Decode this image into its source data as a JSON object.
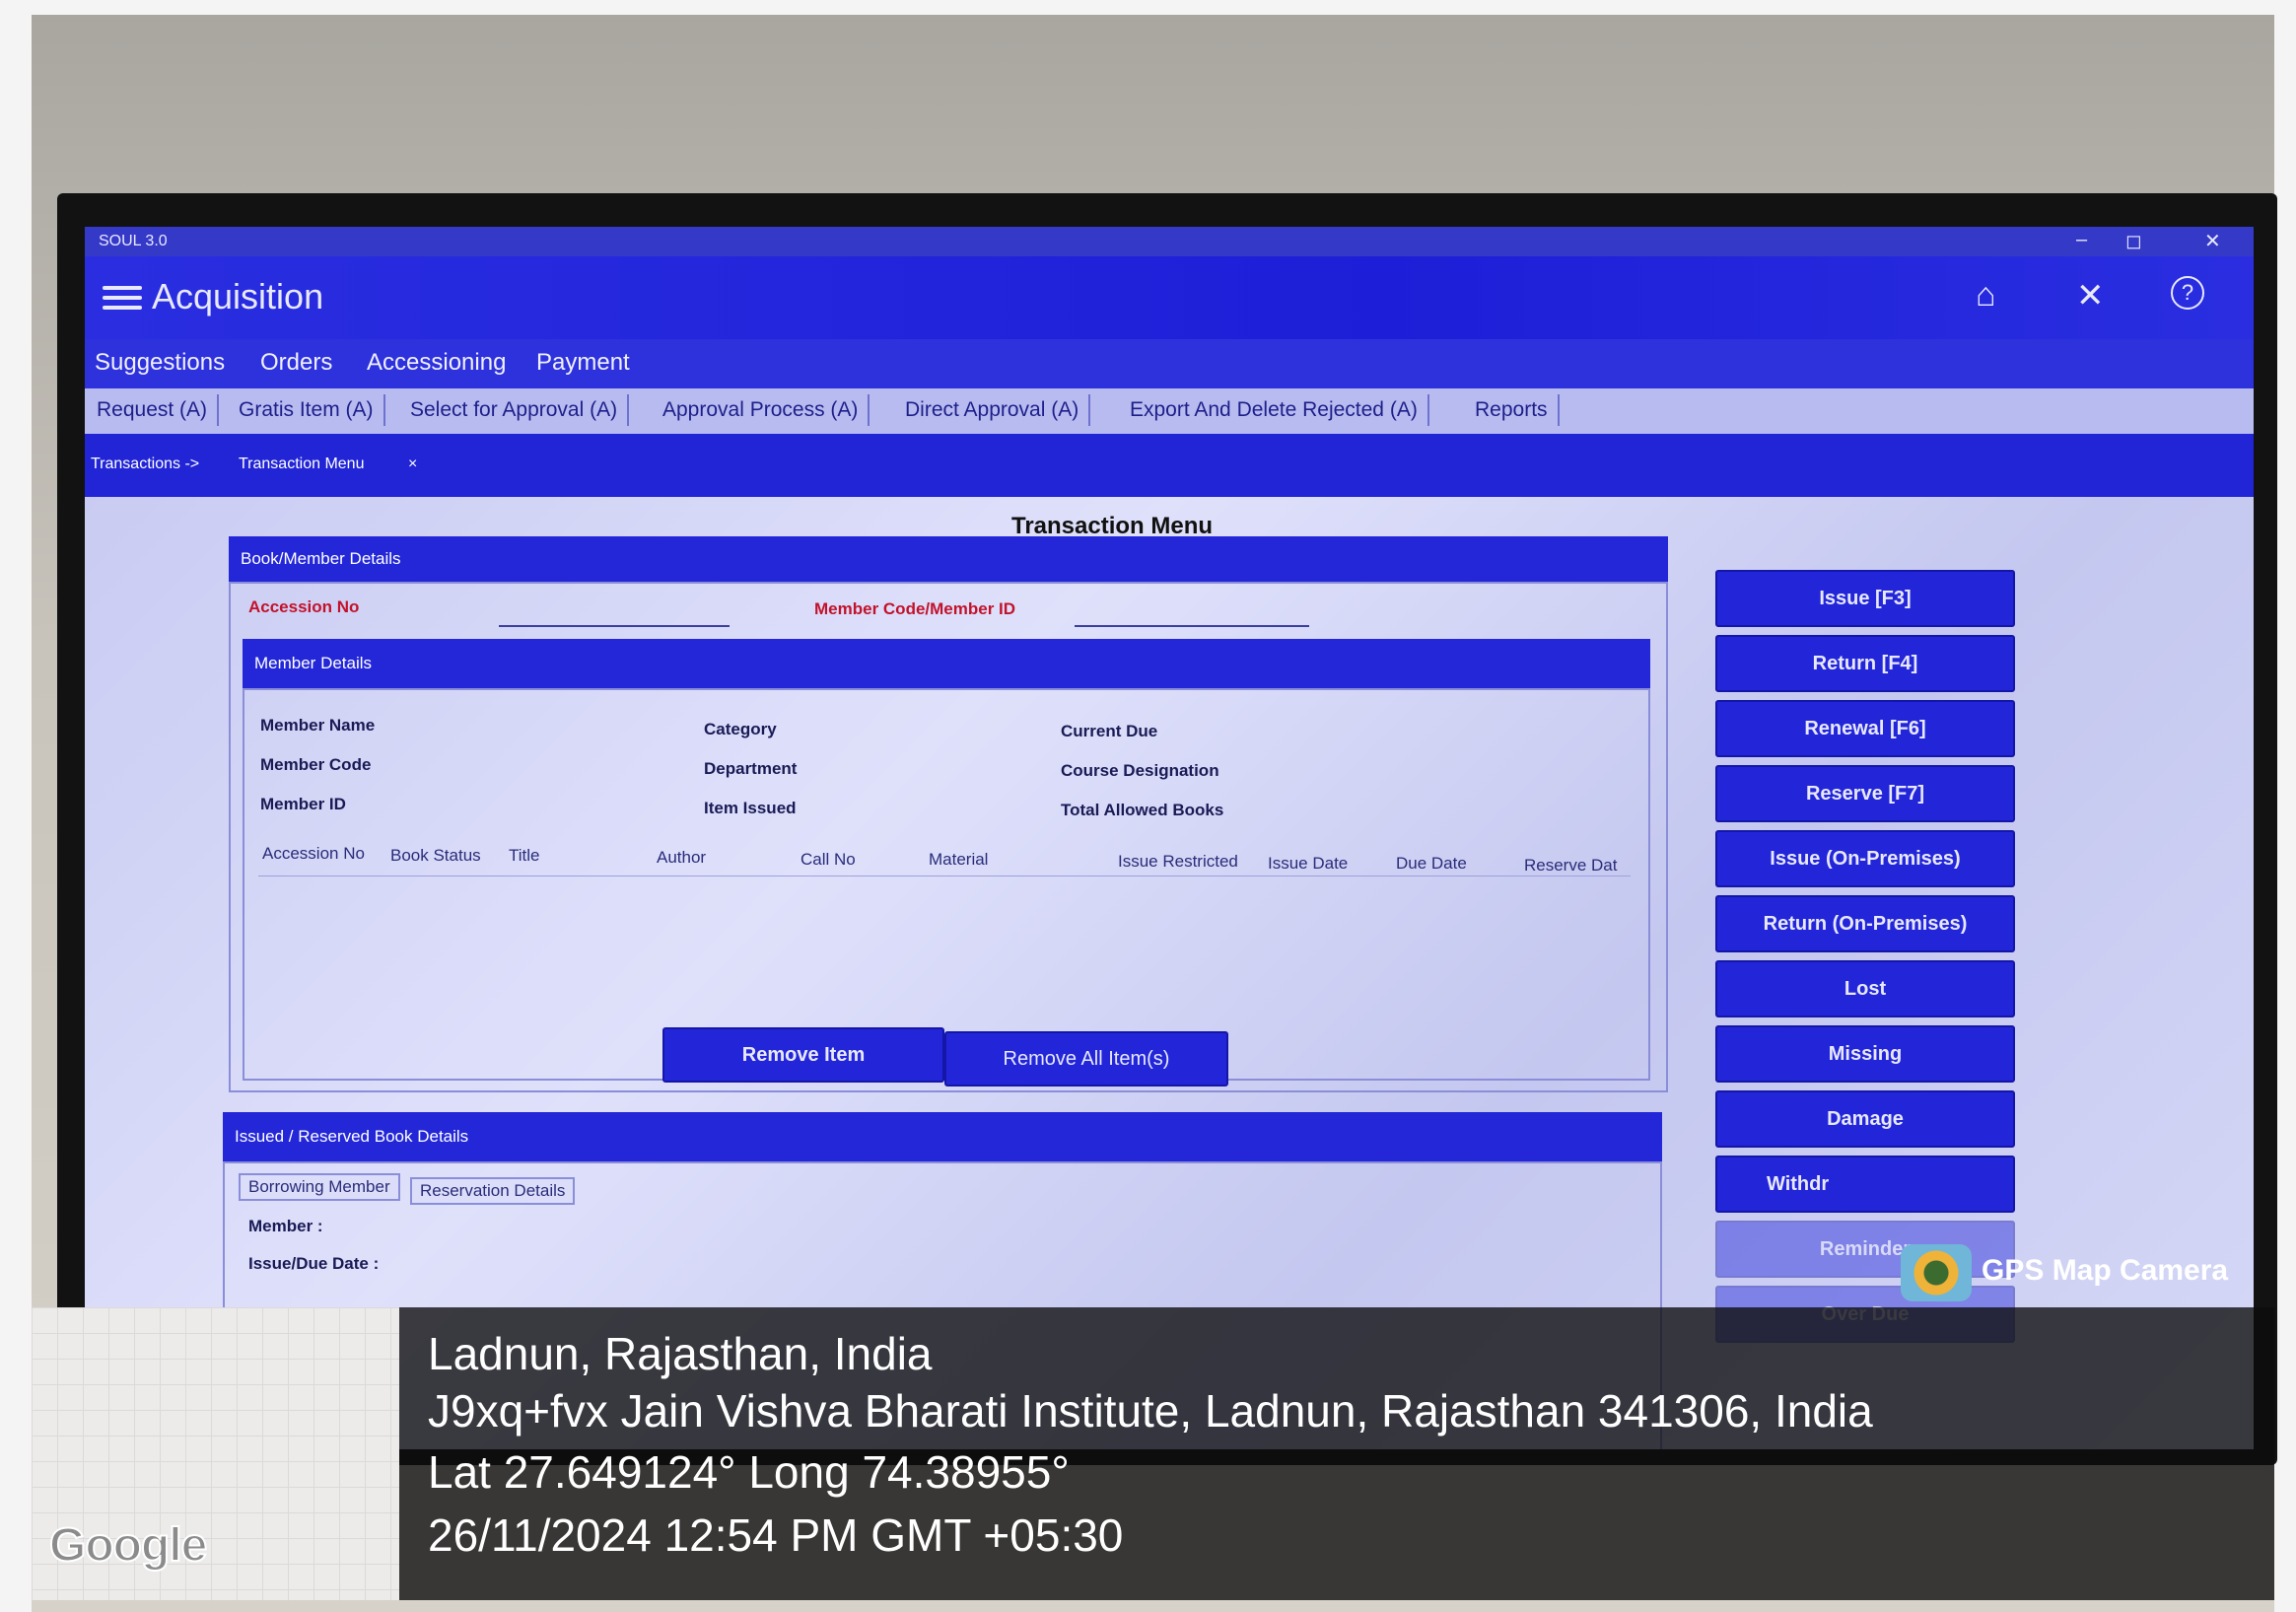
{
  "window": {
    "title": "SOUL 3.0",
    "minimize": "–",
    "maximize": "◻",
    "close": "✕"
  },
  "header": {
    "title": "Acquisition",
    "home_icon": "⌂",
    "close_icon": "✕",
    "help_icon": "?"
  },
  "menu": [
    "Suggestions",
    "Orders",
    "Accessioning",
    "Payment"
  ],
  "tabs": [
    "Request (A)",
    "Gratis Item (A)",
    "Select for Approval (A)",
    "Approval Process (A)",
    "Direct Approval (A)",
    "Export And Delete Rejected (A)",
    "Reports"
  ],
  "breadcrumb": {
    "parent": "Transactions ->",
    "current": "Transaction Menu",
    "close": "×"
  },
  "page": {
    "title": "Transaction Menu"
  },
  "book_member": {
    "heading": "Book/Member Details",
    "accession_label": "Accession No",
    "member_code_label": "Member Code/Member ID"
  },
  "member_details": {
    "heading": "Member Details",
    "labels": [
      "Member Name",
      "Member Code",
      "Member ID",
      "Category",
      "Department",
      "Item Issued",
      "Current Due",
      "Course Designation",
      "Total Allowed Books"
    ],
    "columns": [
      "Accession No",
      "Book Status",
      "Title",
      "Author",
      "Call No",
      "Material",
      "Issue Restricted",
      "Issue Date",
      "Due Date",
      "Reserve Dat"
    ]
  },
  "actions": {
    "remove_item": "Remove Item",
    "remove_all": "Remove All Item(s)"
  },
  "issued_reserved": {
    "heading": "Issued / Reserved Book Details",
    "subtabs": [
      "Borrowing Member",
      "Reservation Details"
    ],
    "member_label": "Member :",
    "issue_due_label": "Issue/Due Date :"
  },
  "side_buttons": [
    "Issue [F3]",
    "Return [F4]",
    "Renewal [F6]",
    "Reserve [F7]",
    "Issue (On-Premises)",
    "Return (On-Premises)",
    "Lost",
    "Missing",
    "Damage",
    "Withdr",
    "Reminder",
    "Over Due"
  ],
  "overlay": {
    "badge": "GPS Map Camera",
    "location": "Ladnun, Rajasthan, India",
    "address": "J9xq+fvx Jain Vishva Bharati Institute, Ladnun, Rajasthan 341306, India",
    "coords": "Lat 27.649124° Long 74.38955°",
    "datetime": "26/11/2024 12:54 PM GMT +05:30",
    "map_brand": "Google"
  }
}
